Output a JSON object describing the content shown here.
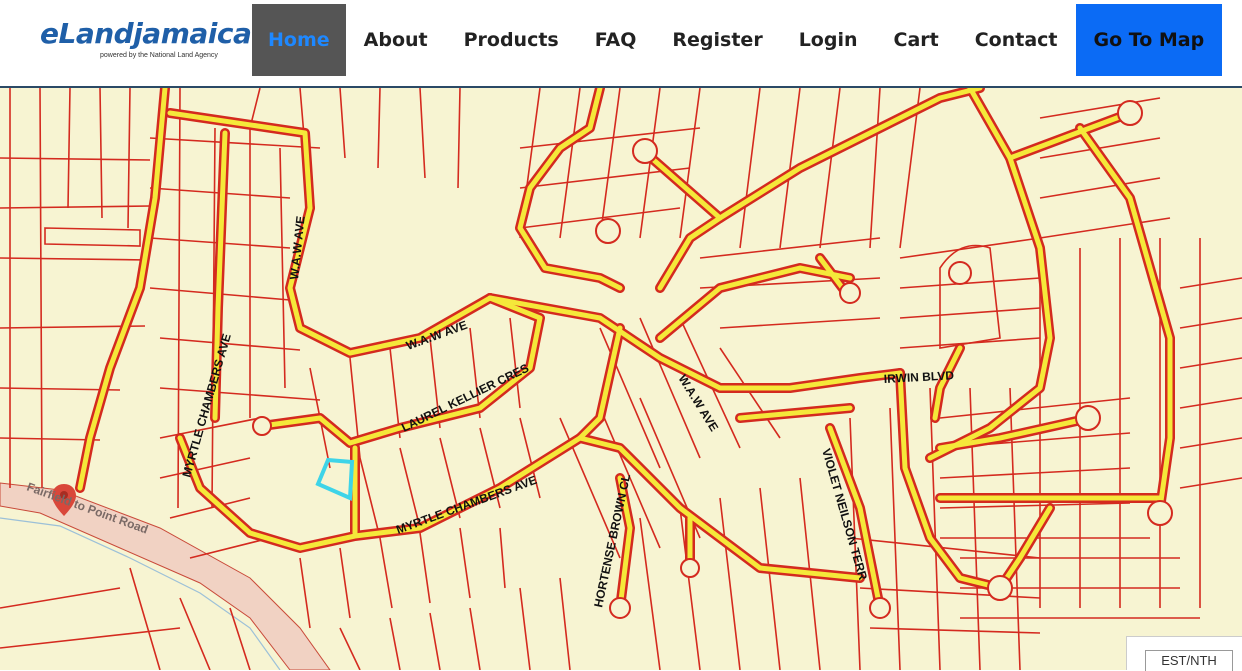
{
  "brand": {
    "name": "eLandjamaica",
    "tagline": "powered by the National Land Agency"
  },
  "nav": {
    "items": [
      {
        "label": "Home"
      },
      {
        "label": "About"
      },
      {
        "label": "Products"
      },
      {
        "label": "FAQ"
      },
      {
        "label": "Register"
      },
      {
        "label": "Login"
      },
      {
        "label": "Cart"
      },
      {
        "label": "Contact"
      },
      {
        "label": "Go To Map"
      }
    ]
  },
  "map": {
    "streets": [
      "W.A.W  AVE",
      "W.A.W  AVE",
      "MYRTLE CHAMBERS  AVE",
      "LAUREL KELLIER  CRES",
      "MYRTLE CHAMBERS  AVE",
      "W.A.W  AVE",
      "IRWIN  BLVD",
      "VIOLET NEILSON  TERR",
      "HORTENSE BROWN  CL",
      "Fairfield to Point Road"
    ],
    "coord_toggle": "EST/NTH",
    "colors": {
      "background": "#f7f4d2",
      "parcel": "#d42a1f",
      "road": "#f5e83a",
      "selected_parcel": "#3ed4e8",
      "marker": "#d9473a"
    }
  }
}
